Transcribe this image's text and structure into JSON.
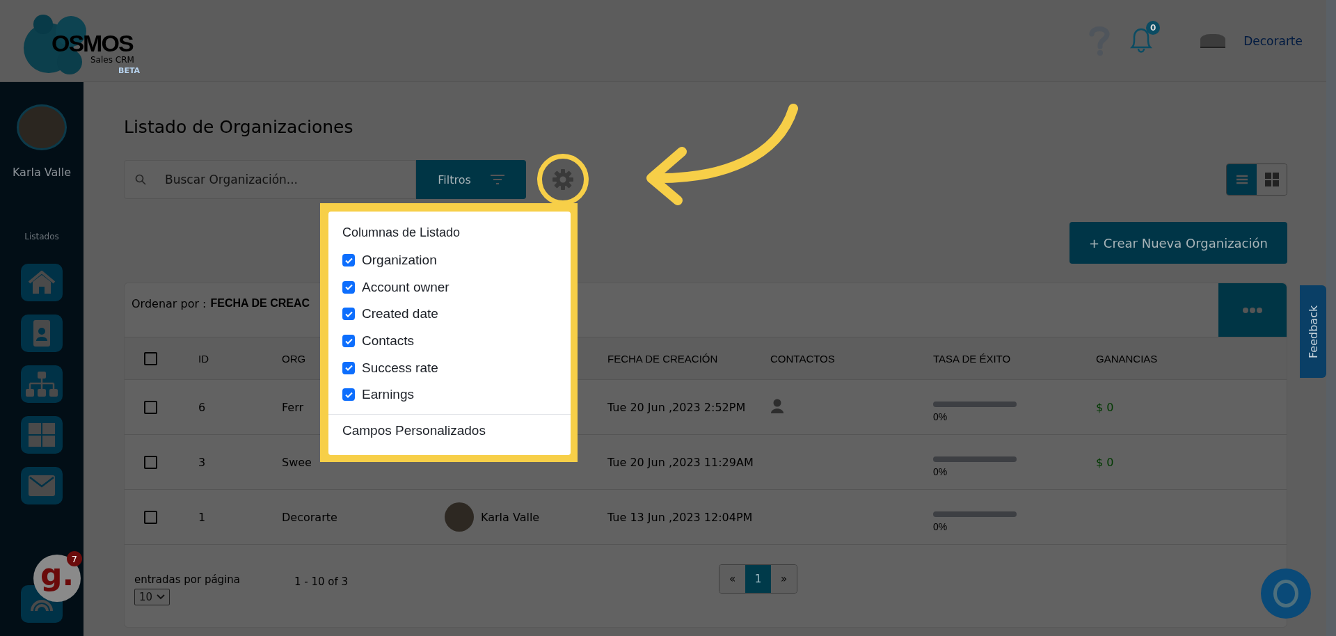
{
  "header": {
    "logo": {
      "name": "OSMOS",
      "subtitle": "Sales CRM",
      "badge": "BETA"
    },
    "notifications": "0",
    "account": "Decorarte"
  },
  "sidebar": {
    "user_name": "Karla Valle",
    "section": "Listados",
    "nav": [
      {
        "kind": "home"
      },
      {
        "kind": "contact"
      },
      {
        "kind": "org"
      },
      {
        "kind": "grid"
      },
      {
        "kind": "mail"
      },
      {
        "kind": "target"
      }
    ],
    "widget": {
      "letter": "g.",
      "badge": "7"
    }
  },
  "page_title": "Listado de Organizaciones",
  "search": {
    "placeholder": "Buscar Organización..."
  },
  "filter_button": "Filtros",
  "view_toggle": [
    {
      "kind": "list",
      "selected": true
    },
    {
      "kind": "grid",
      "selected": false
    }
  ],
  "create_button": "+ Crear Nueva Organización",
  "sort": {
    "label": "Ordenar por :",
    "value": "FECHA DE CREAC"
  },
  "table": {
    "all_selected": false,
    "columns": [
      "ID",
      "ORG",
      "FECHA DE CREACIÓN",
      "CONTACTOS",
      "TASA DE ÉXITO",
      "GANANCIAS"
    ],
    "rows": [
      {
        "selected": false,
        "id": "6",
        "organization": "Ferr",
        "created": "Tue 20 Jun ,2023 2:52PM",
        "has_contact": true,
        "success": {
          "level": 0,
          "reading": "0%"
        },
        "earnings": "$ 0"
      },
      {
        "selected": false,
        "id": "3",
        "organization": "Swee",
        "created": "Tue 20 Jun ,2023 11:29AM",
        "has_contact": false,
        "success": {
          "level": 0,
          "reading": "0%"
        },
        "earnings": "$ 0"
      },
      {
        "selected": false,
        "id": "1",
        "organization": "Decorarte",
        "owner": "Karla Valle",
        "created": "Tue 13 Jun ,2023 12:04PM",
        "has_contact": false,
        "success": {
          "level": 0,
          "reading": "0%"
        }
      }
    ]
  },
  "footer": {
    "per_page_label": "entradas por página",
    "per_page": "10",
    "range": "1 - 10 of 3",
    "pages": [
      {
        "label": "«",
        "selected": false
      },
      {
        "label": "1",
        "selected": true
      },
      {
        "label": "»",
        "selected": false
      }
    ]
  },
  "feedback": "Feedback",
  "column_menu": {
    "title": "Columnas de Listado",
    "options": [
      {
        "label": "Organization",
        "checked": true
      },
      {
        "label": "Account owner",
        "checked": true
      },
      {
        "label": "Created date",
        "checked": true
      },
      {
        "label": "Contacts",
        "checked": true
      },
      {
        "label": "Success rate",
        "checked": true
      },
      {
        "label": "Earnings",
        "checked": true
      }
    ],
    "footer": "Campos Personalizados"
  }
}
